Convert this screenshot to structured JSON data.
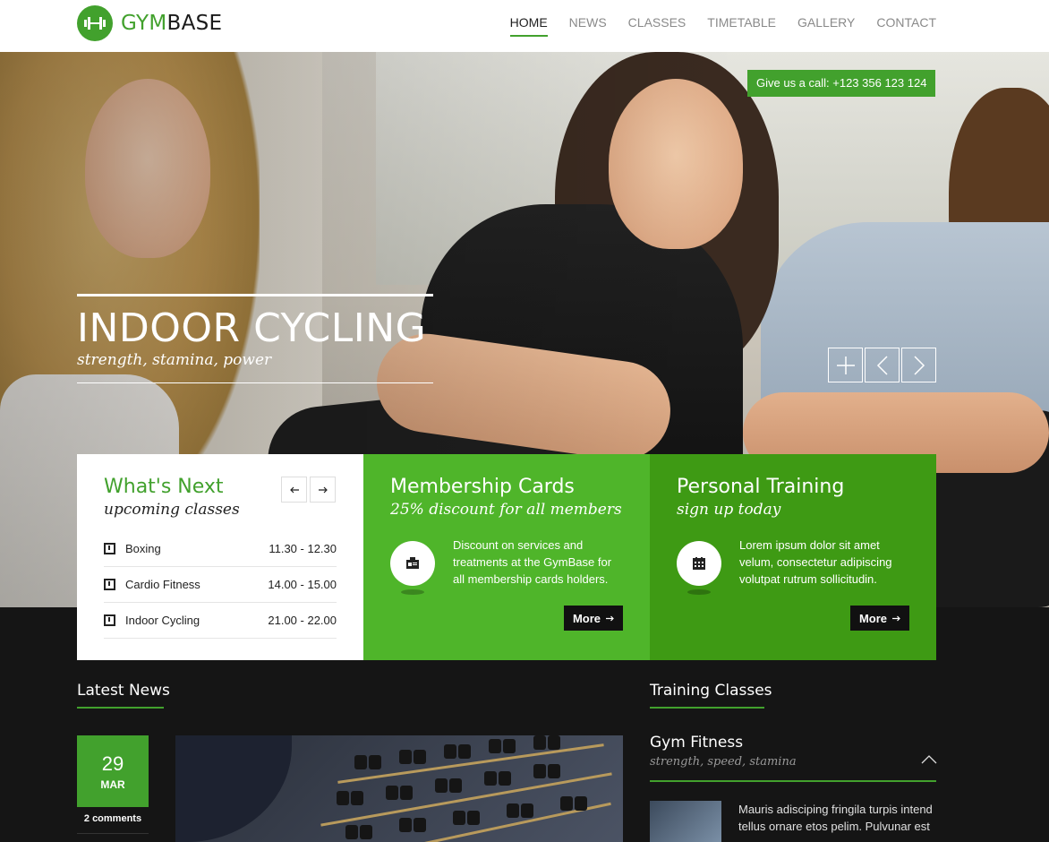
{
  "brand": {
    "part1": "GYM",
    "part2": "BASE"
  },
  "nav": [
    {
      "label": "HOME"
    },
    {
      "label": "NEWS"
    },
    {
      "label": "CLASSES"
    },
    {
      "label": "TIMETABLE"
    },
    {
      "label": "GALLERY"
    },
    {
      "label": "CONTACT"
    }
  ],
  "hero": {
    "call_label": "Give us a call: +123 356 123 124",
    "title": "INDOOR CYCLING",
    "subtitle": "strength, stamina, power"
  },
  "whats_next": {
    "title": "What's Next",
    "subtitle": "upcoming classes",
    "classes": [
      {
        "name": "Boxing",
        "time": "11.30 - 12.30"
      },
      {
        "name": "Cardio Fitness",
        "time": "14.00 - 15.00"
      },
      {
        "name": "Indoor Cycling",
        "time": "21.00 - 22.00"
      }
    ]
  },
  "membership": {
    "title": "Membership Cards",
    "subtitle": "25% discount for all members",
    "text": "Discount on services and treatments at the GymBase for all membership cards holders.",
    "more_label": "More"
  },
  "training": {
    "title": "Personal Training",
    "subtitle": "sign up today",
    "text": "Lorem ipsum dolor sit amet velum, consectetur adipiscing volutpat rutrum sollicitudin.",
    "more_label": "More"
  },
  "latest_news": {
    "heading": "Latest News",
    "day": "29",
    "month": "MAR",
    "comments": "2 comments"
  },
  "training_classes": {
    "heading": "Training Classes",
    "item_title": "Gym Fitness",
    "item_subtitle": "strength, speed, stamina",
    "item_text": "Mauris adisciping fringila turpis intend tellus ornare etos pelim. Pulvunar est"
  },
  "colors": {
    "accent": "#42a12d",
    "green_light": "#4fb52a",
    "green_dark": "#3e9a14",
    "dark_bg": "#151515"
  }
}
